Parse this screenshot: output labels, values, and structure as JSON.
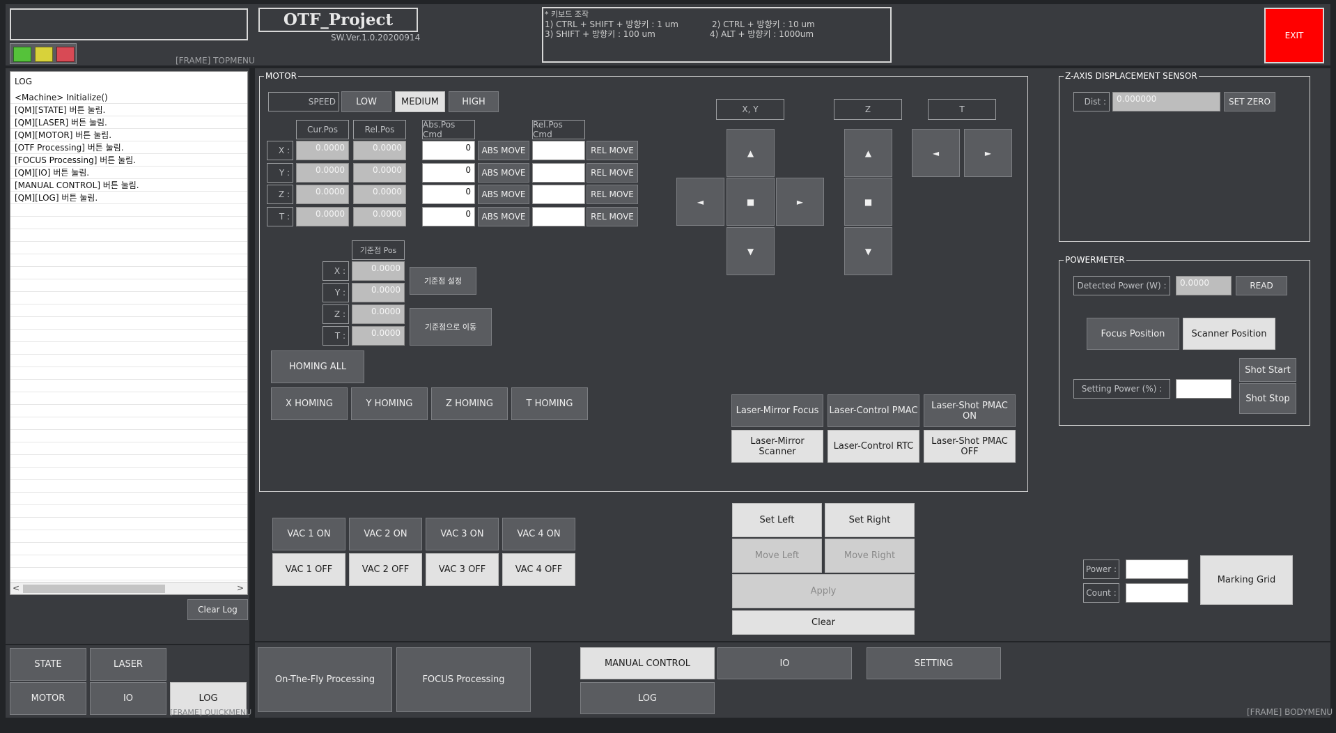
{
  "topmenu": {
    "frame_tag": "[FRAME] TOPMENU",
    "title": "OTF_Project",
    "version": "SW.Ver.1.0.20200914",
    "status_lights": [
      "green",
      "yellow",
      "red"
    ],
    "keyboard_help": {
      "heading": "* 키보드 조작",
      "line1a": "1) CTRL + SHIFT + 방향키 : 1 um",
      "line1b": "2) CTRL + 방향키 : 10 um",
      "line2a": "3) SHIFT + 방향키 : 100 um",
      "line2b": "4) ALT + 방향키 : 1000um"
    },
    "exit_label": "EXIT"
  },
  "log_panel": {
    "header": "LOG",
    "lines": [
      "<Machine> Initialize()",
      "[QM][STATE] 버튼 눌림.",
      "[QM][LASER] 버튼 눌림.",
      "[QM][MOTOR] 버튼 눌림.",
      "[OTF Processing] 버튼 눌림.",
      "[FOCUS Processing] 버튼 눌림.",
      "[QM][IO] 버튼 눌림.",
      "[MANUAL CONTROL] 버튼 눌림.",
      "[QM][LOG] 버튼 눌림."
    ],
    "clear_label": "Clear Log"
  },
  "quick_menu": {
    "state": "STATE",
    "laser": "LASER",
    "motor": "MOTOR",
    "io": "IO",
    "log": "LOG",
    "frame_tag": "[FRAME] QUICKMENU"
  },
  "motor": {
    "title": "MOTOR",
    "speed_label": "SPEED",
    "speed_low": "LOW",
    "speed_medium": "MEDIUM",
    "speed_high": "HIGH",
    "col_cur": "Cur.Pos",
    "col_rel": "Rel.Pos",
    "col_abs_cmd": "Abs.Pos Cmd",
    "col_rel_cmd": "Rel.Pos Cmd",
    "abs_move": "ABS MOVE",
    "rel_move": "REL MOVE",
    "axes": [
      {
        "name": "X :",
        "cur": "0.0000",
        "rel": "0.0000",
        "abs_cmd": "0"
      },
      {
        "name": "Y :",
        "cur": "0.0000",
        "rel": "0.0000",
        "abs_cmd": "0"
      },
      {
        "name": "Z :",
        "cur": "0.0000",
        "rel": "0.0000",
        "abs_cmd": "0"
      },
      {
        "name": "T :",
        "cur": "0.0000",
        "rel": "0.0000",
        "abs_cmd": "0"
      }
    ],
    "ref_header": "기준점 Pos",
    "ref_axes": [
      {
        "name": "X :",
        "val": "0.0000"
      },
      {
        "name": "Y :",
        "val": "0.0000"
      },
      {
        "name": "Z :",
        "val": "0.0000"
      },
      {
        "name": "T :",
        "val": "0.0000"
      }
    ],
    "ref_set": "기준점 설정",
    "ref_move": "기준점으로 이동",
    "homing_all": "HOMING ALL",
    "x_homing": "X HOMING",
    "y_homing": "Y HOMING",
    "z_homing": "Z HOMING",
    "t_homing": "T HOMING",
    "jog_xy": "X, Y",
    "jog_z": "Z",
    "jog_t": "T",
    "arrow_up": "▲",
    "arrow_down": "▼",
    "arrow_left": "◄",
    "arrow_right": "►",
    "stop": "■",
    "laser_mirror_focus": "Laser-Mirror Focus",
    "laser_control_pmac": "Laser-Control PMAC",
    "laser_shot_pmac_on": "Laser-Shot PMAC ON",
    "laser_mirror_scanner": "Laser-Mirror Scanner",
    "laser_control_rtc": "Laser-Control RTC",
    "laser_shot_pmac_off": "Laser-Shot PMAC OFF"
  },
  "z_sensor": {
    "title": "Z-AXIS  DISPLACEMENT SENSOR",
    "dist_label": "Dist :",
    "dist_value": "0.000000",
    "set_zero": "SET ZERO"
  },
  "powermeter": {
    "title": "POWERMETER",
    "detected_label": "Detected Power (W) :",
    "detected_value": "0.0000",
    "read": "READ",
    "focus_position": "Focus Position",
    "scanner_position": "Scanner Position",
    "setting_label": "Setting Power (%) :",
    "setting_value": "",
    "shot_start": "Shot Start",
    "shot_stop": "Shot Stop"
  },
  "vac": {
    "on": [
      "VAC 1 ON",
      "VAC 2 ON",
      "VAC 3 ON",
      "VAC 4 ON"
    ],
    "off": [
      "VAC 1 OFF",
      "VAC 2 OFF",
      "VAC 3 OFF",
      "VAC 4 OFF"
    ]
  },
  "positioning": {
    "set_left": "Set Left",
    "set_right": "Set Right",
    "move_left": "Move Left",
    "move_right": "Move Right",
    "apply": "Apply",
    "clear": "Clear"
  },
  "marking": {
    "power_label": "Power :",
    "count_label": "Count :",
    "power_value": "",
    "count_value": "",
    "grid": "Marking Grid"
  },
  "bodymenu": {
    "otf": "On-The-Fly Processing",
    "focus": "FOCUS Processing",
    "manual": "MANUAL CONTROL",
    "io": "IO",
    "setting": "SETTING",
    "log": "LOG",
    "frame_tag": "[FRAME] BODYMENU"
  },
  "colors": {
    "background": "#222427",
    "panel": "#393b3f",
    "button": "#5a5c60",
    "exit": "#ff0000",
    "light_green": "#55c23a",
    "light_yellow": "#d8d23a",
    "light_red": "#d84a55"
  }
}
